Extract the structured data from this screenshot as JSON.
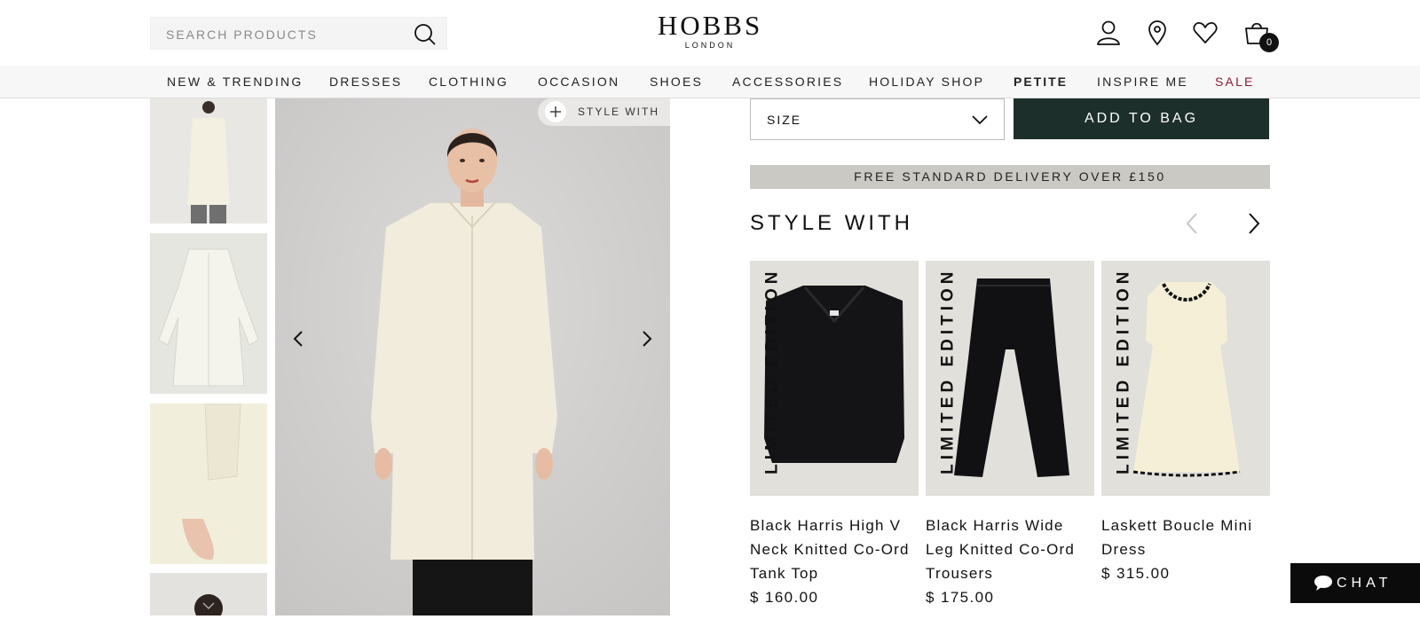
{
  "header": {
    "search_placeholder": "SEARCH PRODUCTS",
    "logo_main": "HOBBS",
    "logo_sub": "LONDON",
    "cart_count": "0"
  },
  "nav": {
    "items": [
      "NEW & TRENDING",
      "DRESSES",
      "CLOTHING",
      "OCCASION",
      "SHOES",
      "ACCESSORIES",
      "HOLIDAY SHOP",
      "PETITE",
      "INSPIRE ME",
      "SALE"
    ]
  },
  "gallery": {
    "style_with_label": "STYLE WITH"
  },
  "purchase": {
    "size_label": "SIZE",
    "add_to_bag": "ADD TO BAG",
    "delivery_banner": "FREE STANDARD DELIVERY OVER £150"
  },
  "style_with": {
    "title": "STYLE WITH",
    "products": [
      {
        "badge": "LIMITED EDITION",
        "name": "Black Harris High V Neck Knitted Co-Ord Tank Top",
        "price": "$ 160.00"
      },
      {
        "badge": "LIMITED EDITION",
        "name": "Black Harris Wide Leg Knitted Co-Ord Trousers",
        "price": "$ 175.00"
      },
      {
        "badge": "LIMITED EDITION",
        "name": "Laskett Boucle Mini Dress",
        "price": "$ 315.00"
      }
    ]
  },
  "chat": {
    "label": "CHAT"
  },
  "colors": {
    "accent_dark_green": "#1c2f2b",
    "sale_red": "#8c1b37",
    "banner_grey": "#cbc9c4"
  }
}
